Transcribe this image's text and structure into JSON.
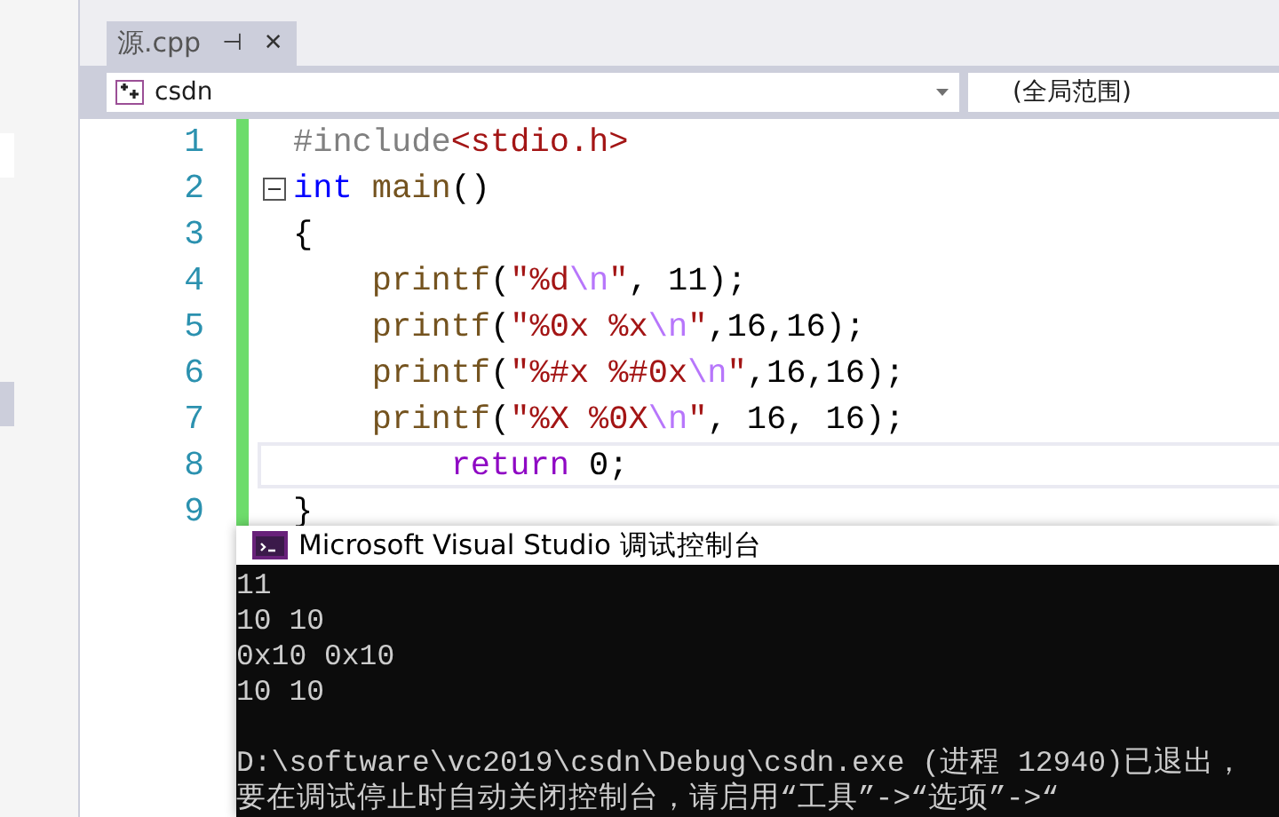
{
  "tab": {
    "title": "源.cpp",
    "selected": true,
    "pin": "⊣",
    "close": "✕"
  },
  "navigation": {
    "project": "csdn",
    "scope": "(全局范围)"
  },
  "code_lines": [
    {
      "number": "1",
      "current": false,
      "fold_marker": false,
      "tokens": [
        {
          "kind": "preprocessor",
          "text": "#include"
        },
        {
          "kind": "string",
          "text": "<stdio.h>"
        }
      ]
    },
    {
      "number": "2",
      "current": false,
      "fold_marker": true,
      "tokens": [
        {
          "kind": "keyword",
          "text": "int"
        },
        {
          "kind": "function",
          "text": " main"
        },
        {
          "kind": "plain",
          "text": "()"
        }
      ]
    },
    {
      "number": "3",
      "current": false,
      "fold_marker": false,
      "tokens": [
        {
          "kind": "plain",
          "text": "{"
        }
      ]
    },
    {
      "number": "4",
      "current": false,
      "fold_marker": false,
      "tokens": [
        {
          "kind": "function",
          "text": "    printf"
        },
        {
          "kind": "plain",
          "text": "("
        },
        {
          "kind": "string",
          "text": "\"%d"
        },
        {
          "kind": "escape",
          "text": "\\n"
        },
        {
          "kind": "string",
          "text": "\""
        },
        {
          "kind": "plain",
          "text": ", 11);"
        }
      ]
    },
    {
      "number": "5",
      "current": false,
      "fold_marker": false,
      "tokens": [
        {
          "kind": "function",
          "text": "    printf"
        },
        {
          "kind": "plain",
          "text": "("
        },
        {
          "kind": "string",
          "text": "\"%0x %x"
        },
        {
          "kind": "escape",
          "text": "\\n"
        },
        {
          "kind": "string",
          "text": "\""
        },
        {
          "kind": "plain",
          "text": ",16,16);"
        }
      ]
    },
    {
      "number": "6",
      "current": false,
      "fold_marker": false,
      "tokens": [
        {
          "kind": "function",
          "text": "    printf"
        },
        {
          "kind": "plain",
          "text": "("
        },
        {
          "kind": "string",
          "text": "\"%#x %#0x"
        },
        {
          "kind": "escape",
          "text": "\\n"
        },
        {
          "kind": "string",
          "text": "\""
        },
        {
          "kind": "plain",
          "text": ",16,16);"
        }
      ]
    },
    {
      "number": "7",
      "current": false,
      "fold_marker": false,
      "tokens": [
        {
          "kind": "function",
          "text": "    printf"
        },
        {
          "kind": "plain",
          "text": "("
        },
        {
          "kind": "string",
          "text": "\"%X %0X"
        },
        {
          "kind": "escape",
          "text": "\\n"
        },
        {
          "kind": "string",
          "text": "\""
        },
        {
          "kind": "plain",
          "text": ", 16, 16);"
        }
      ]
    },
    {
      "number": "8",
      "current": true,
      "fold_marker": false,
      "tokens": [
        {
          "kind": "keyword2",
          "text": "        return"
        },
        {
          "kind": "plain",
          "text": " 0;"
        }
      ]
    },
    {
      "number": "9",
      "current": false,
      "fold_marker": false,
      "tokens": [
        {
          "kind": "plain",
          "text": "}"
        }
      ]
    }
  ],
  "console": {
    "title": "Microsoft Visual Studio 调试控制台",
    "output_lines": [
      "11",
      "10 10",
      "0x10 0x10",
      "10 10"
    ],
    "exit_message_lines": [
      "D:\\software\\vc2019\\csdn\\Debug\\csdn.exe (进程 12940)已退出，",
      "要在调试停止时自动关闭控制台，请启用“工具”->“选项”->“"
    ]
  }
}
